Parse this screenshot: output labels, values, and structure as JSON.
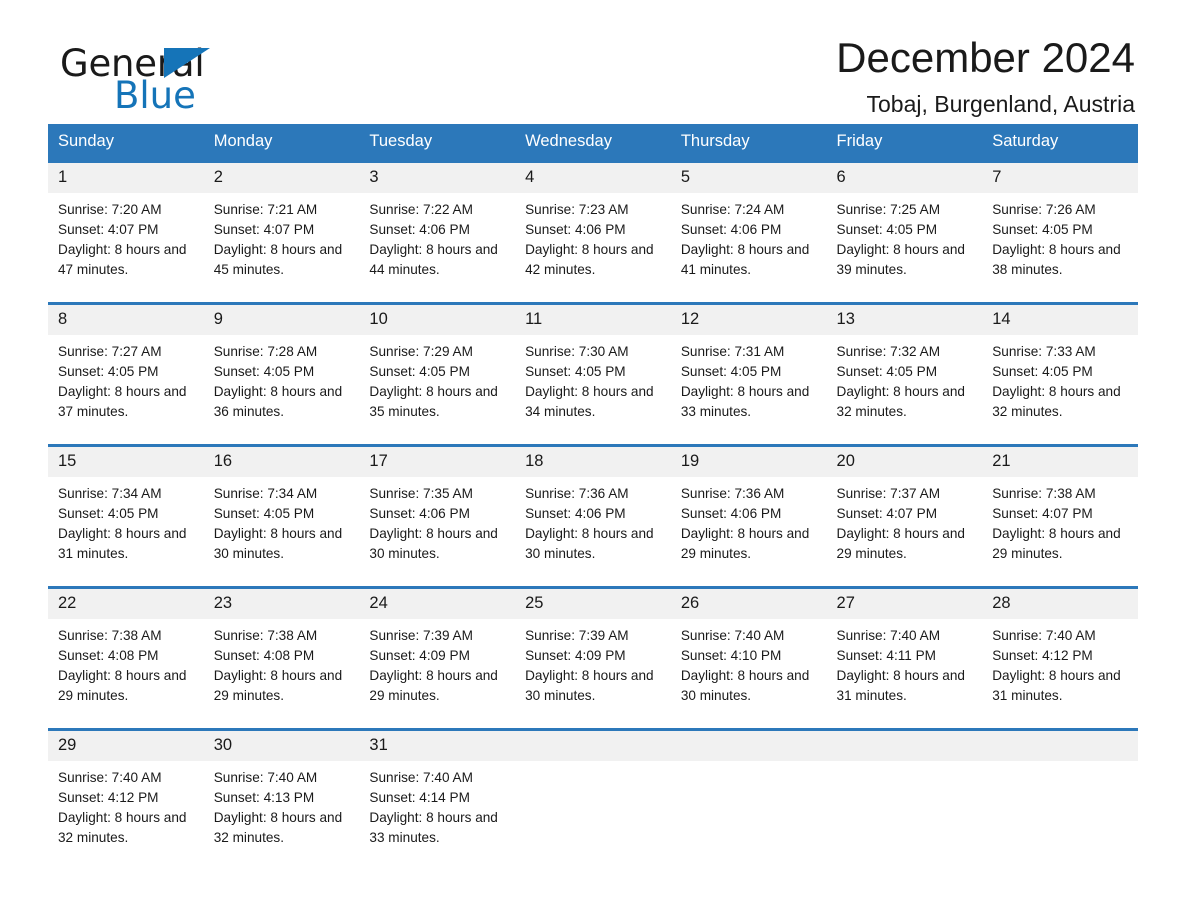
{
  "brand": {
    "name_part1": "General",
    "name_part2": "Blue",
    "triangle_icon": "triangle-icon",
    "accent_color": "#1574b8"
  },
  "header": {
    "month_title": "December 2024",
    "location": "Tobaj, Burgenland, Austria"
  },
  "theme": {
    "header_blue": "#2c78ba",
    "daynum_band": "#f1f1f1",
    "text": "#1a1a1a"
  },
  "weekday_headers": [
    "Sunday",
    "Monday",
    "Tuesday",
    "Wednesday",
    "Thursday",
    "Friday",
    "Saturday"
  ],
  "weeks": [
    {
      "days": [
        {
          "num": "1",
          "sunrise": "Sunrise: 7:20 AM",
          "sunset": "Sunset: 4:07 PM",
          "daylight": "Daylight: 8 hours and 47 minutes."
        },
        {
          "num": "2",
          "sunrise": "Sunrise: 7:21 AM",
          "sunset": "Sunset: 4:07 PM",
          "daylight": "Daylight: 8 hours and 45 minutes."
        },
        {
          "num": "3",
          "sunrise": "Sunrise: 7:22 AM",
          "sunset": "Sunset: 4:06 PM",
          "daylight": "Daylight: 8 hours and 44 minutes."
        },
        {
          "num": "4",
          "sunrise": "Sunrise: 7:23 AM",
          "sunset": "Sunset: 4:06 PM",
          "daylight": "Daylight: 8 hours and 42 minutes."
        },
        {
          "num": "5",
          "sunrise": "Sunrise: 7:24 AM",
          "sunset": "Sunset: 4:06 PM",
          "daylight": "Daylight: 8 hours and 41 minutes."
        },
        {
          "num": "6",
          "sunrise": "Sunrise: 7:25 AM",
          "sunset": "Sunset: 4:05 PM",
          "daylight": "Daylight: 8 hours and 39 minutes."
        },
        {
          "num": "7",
          "sunrise": "Sunrise: 7:26 AM",
          "sunset": "Sunset: 4:05 PM",
          "daylight": "Daylight: 8 hours and 38 minutes."
        }
      ]
    },
    {
      "days": [
        {
          "num": "8",
          "sunrise": "Sunrise: 7:27 AM",
          "sunset": "Sunset: 4:05 PM",
          "daylight": "Daylight: 8 hours and 37 minutes."
        },
        {
          "num": "9",
          "sunrise": "Sunrise: 7:28 AM",
          "sunset": "Sunset: 4:05 PM",
          "daylight": "Daylight: 8 hours and 36 minutes."
        },
        {
          "num": "10",
          "sunrise": "Sunrise: 7:29 AM",
          "sunset": "Sunset: 4:05 PM",
          "daylight": "Daylight: 8 hours and 35 minutes."
        },
        {
          "num": "11",
          "sunrise": "Sunrise: 7:30 AM",
          "sunset": "Sunset: 4:05 PM",
          "daylight": "Daylight: 8 hours and 34 minutes."
        },
        {
          "num": "12",
          "sunrise": "Sunrise: 7:31 AM",
          "sunset": "Sunset: 4:05 PM",
          "daylight": "Daylight: 8 hours and 33 minutes."
        },
        {
          "num": "13",
          "sunrise": "Sunrise: 7:32 AM",
          "sunset": "Sunset: 4:05 PM",
          "daylight": "Daylight: 8 hours and 32 minutes."
        },
        {
          "num": "14",
          "sunrise": "Sunrise: 7:33 AM",
          "sunset": "Sunset: 4:05 PM",
          "daylight": "Daylight: 8 hours and 32 minutes."
        }
      ]
    },
    {
      "days": [
        {
          "num": "15",
          "sunrise": "Sunrise: 7:34 AM",
          "sunset": "Sunset: 4:05 PM",
          "daylight": "Daylight: 8 hours and 31 minutes."
        },
        {
          "num": "16",
          "sunrise": "Sunrise: 7:34 AM",
          "sunset": "Sunset: 4:05 PM",
          "daylight": "Daylight: 8 hours and 30 minutes."
        },
        {
          "num": "17",
          "sunrise": "Sunrise: 7:35 AM",
          "sunset": "Sunset: 4:06 PM",
          "daylight": "Daylight: 8 hours and 30 minutes."
        },
        {
          "num": "18",
          "sunrise": "Sunrise: 7:36 AM",
          "sunset": "Sunset: 4:06 PM",
          "daylight": "Daylight: 8 hours and 30 minutes."
        },
        {
          "num": "19",
          "sunrise": "Sunrise: 7:36 AM",
          "sunset": "Sunset: 4:06 PM",
          "daylight": "Daylight: 8 hours and 29 minutes."
        },
        {
          "num": "20",
          "sunrise": "Sunrise: 7:37 AM",
          "sunset": "Sunset: 4:07 PM",
          "daylight": "Daylight: 8 hours and 29 minutes."
        },
        {
          "num": "21",
          "sunrise": "Sunrise: 7:38 AM",
          "sunset": "Sunset: 4:07 PM",
          "daylight": "Daylight: 8 hours and 29 minutes."
        }
      ]
    },
    {
      "days": [
        {
          "num": "22",
          "sunrise": "Sunrise: 7:38 AM",
          "sunset": "Sunset: 4:08 PM",
          "daylight": "Daylight: 8 hours and 29 minutes."
        },
        {
          "num": "23",
          "sunrise": "Sunrise: 7:38 AM",
          "sunset": "Sunset: 4:08 PM",
          "daylight": "Daylight: 8 hours and 29 minutes."
        },
        {
          "num": "24",
          "sunrise": "Sunrise: 7:39 AM",
          "sunset": "Sunset: 4:09 PM",
          "daylight": "Daylight: 8 hours and 29 minutes."
        },
        {
          "num": "25",
          "sunrise": "Sunrise: 7:39 AM",
          "sunset": "Sunset: 4:09 PM",
          "daylight": "Daylight: 8 hours and 30 minutes."
        },
        {
          "num": "26",
          "sunrise": "Sunrise: 7:40 AM",
          "sunset": "Sunset: 4:10 PM",
          "daylight": "Daylight: 8 hours and 30 minutes."
        },
        {
          "num": "27",
          "sunrise": "Sunrise: 7:40 AM",
          "sunset": "Sunset: 4:11 PM",
          "daylight": "Daylight: 8 hours and 31 minutes."
        },
        {
          "num": "28",
          "sunrise": "Sunrise: 7:40 AM",
          "sunset": "Sunset: 4:12 PM",
          "daylight": "Daylight: 8 hours and 31 minutes."
        }
      ]
    },
    {
      "days": [
        {
          "num": "29",
          "sunrise": "Sunrise: 7:40 AM",
          "sunset": "Sunset: 4:12 PM",
          "daylight": "Daylight: 8 hours and 32 minutes."
        },
        {
          "num": "30",
          "sunrise": "Sunrise: 7:40 AM",
          "sunset": "Sunset: 4:13 PM",
          "daylight": "Daylight: 8 hours and 32 minutes."
        },
        {
          "num": "31",
          "sunrise": "Sunrise: 7:40 AM",
          "sunset": "Sunset: 4:14 PM",
          "daylight": "Daylight: 8 hours and 33 minutes."
        },
        {
          "num": "",
          "sunrise": "",
          "sunset": "",
          "daylight": ""
        },
        {
          "num": "",
          "sunrise": "",
          "sunset": "",
          "daylight": ""
        },
        {
          "num": "",
          "sunrise": "",
          "sunset": "",
          "daylight": ""
        },
        {
          "num": "",
          "sunrise": "",
          "sunset": "",
          "daylight": ""
        }
      ]
    }
  ]
}
